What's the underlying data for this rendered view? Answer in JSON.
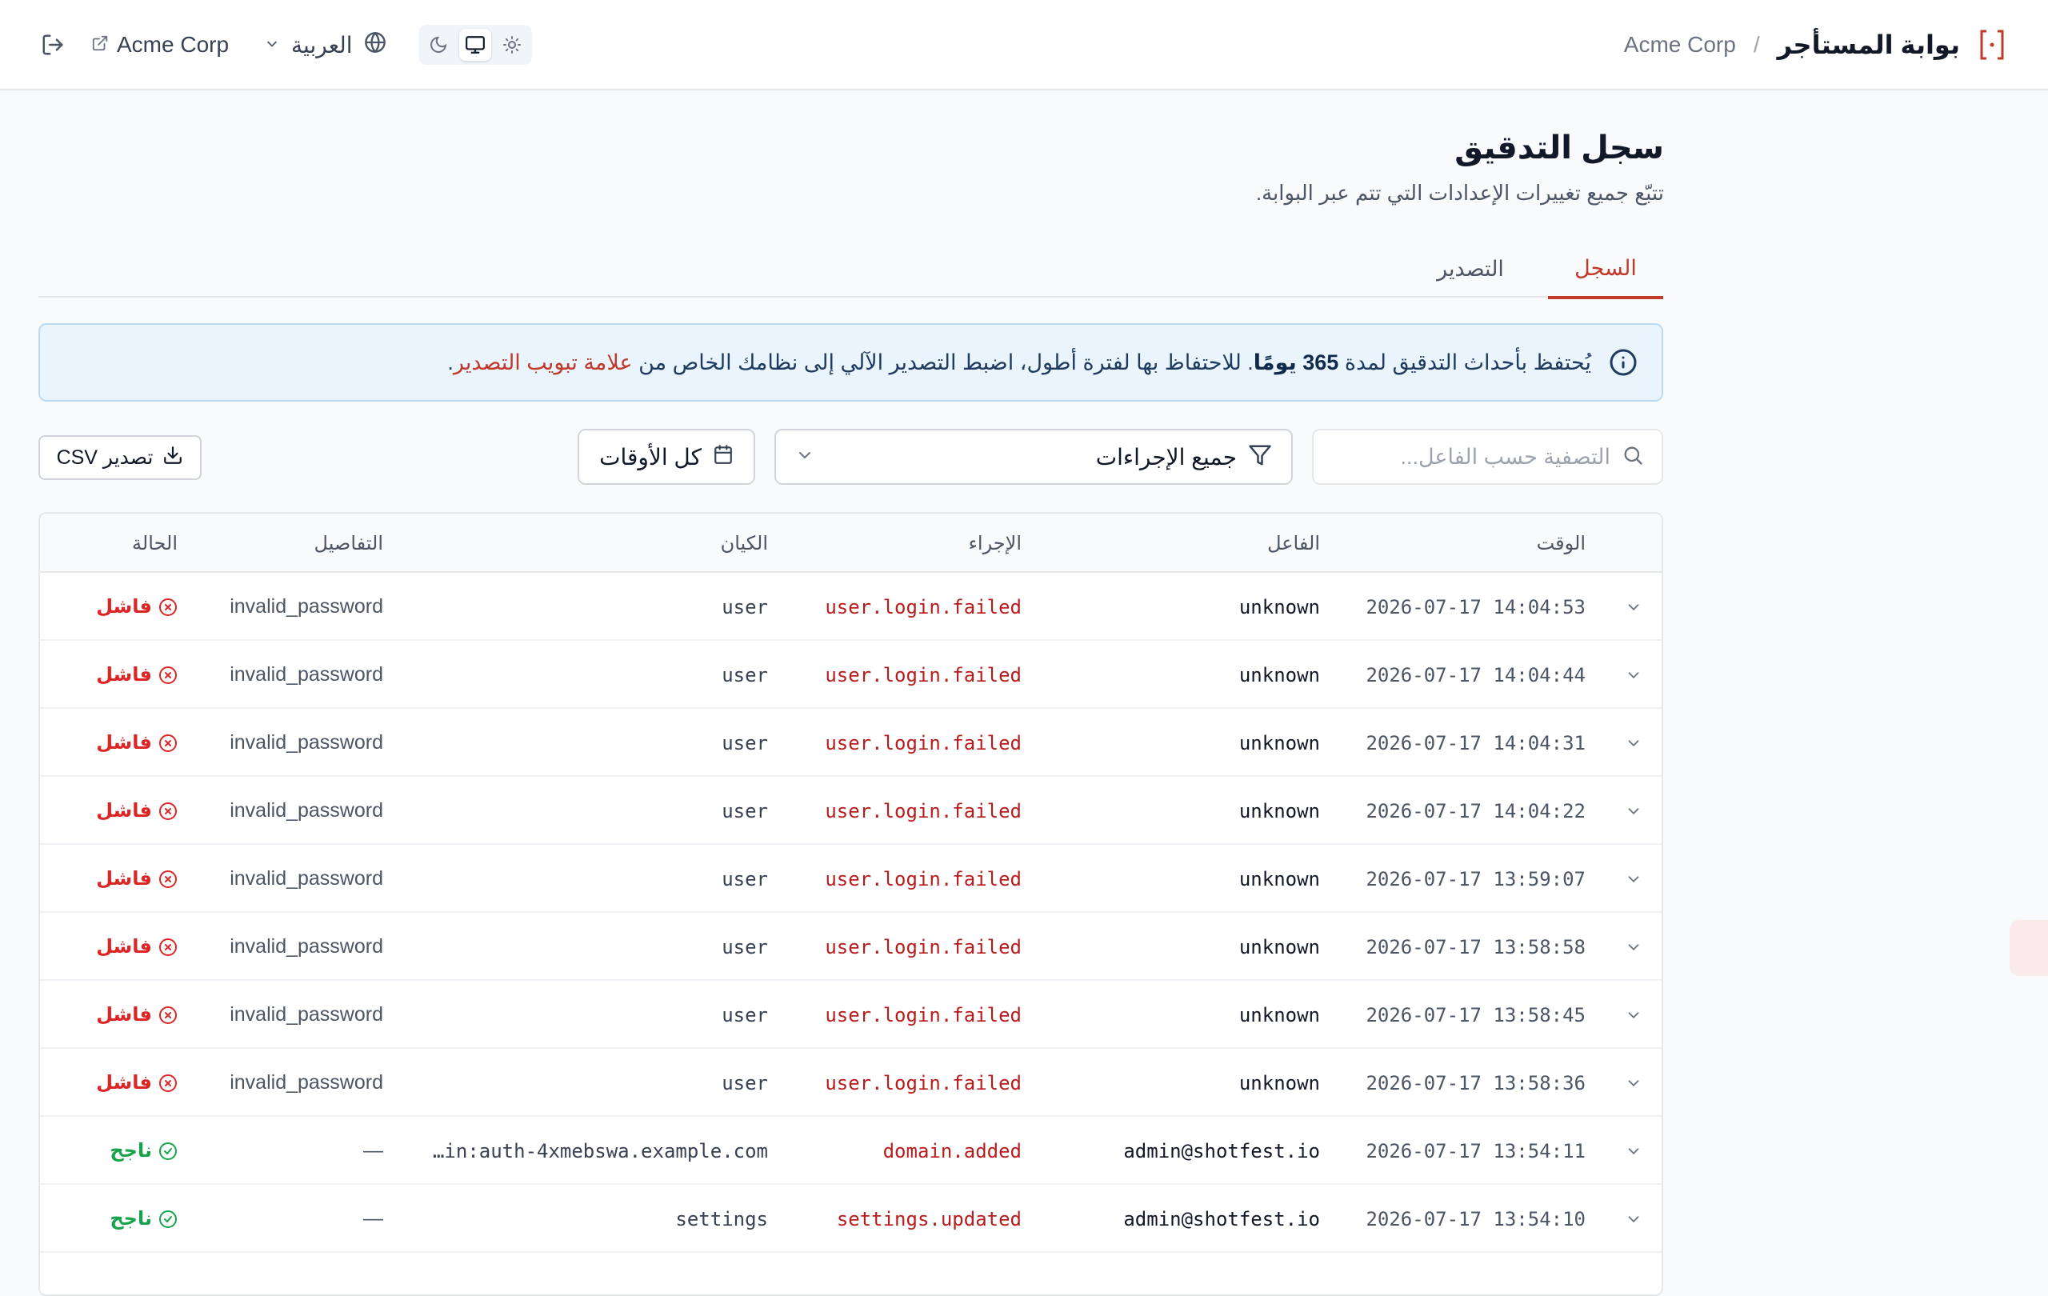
{
  "header": {
    "portal_title": "بوابة المستأجر",
    "separator": "/",
    "tenant_name": "Acme Corp",
    "tenant_link": "Acme Corp",
    "language": "العربية"
  },
  "page": {
    "title": "سجل التدقيق",
    "subtitle": "تتبّع جميع تغييرات الإعدادات التي تتم عبر البوابة."
  },
  "tabs": [
    {
      "label": "السجل",
      "active": true
    },
    {
      "label": "التصدير",
      "active": false
    }
  ],
  "banner": {
    "prefix": "يُحتفظ بأحداث التدقيق لمدة",
    "retention": "365 يومًا",
    "middle": ". للاحتفاظ بها لفترة أطول، اضبط التصدير الآلي إلى نظامك الخاص من",
    "link": "علامة تبويب التصدير",
    "suffix": "."
  },
  "filters": {
    "search_placeholder": "التصفية حسب الفاعل...",
    "search_value": "",
    "action_filter": "جميع الإجراءات",
    "time_filter": "كل الأوقات",
    "export_csv": "تصدير CSV"
  },
  "table": {
    "columns": {
      "time": "الوقت",
      "actor": "الفاعل",
      "action": "الإجراء",
      "entity": "الكيان",
      "details": "التفاصيل",
      "status": "الحالة"
    },
    "status_labels": {
      "failed": "فاشل",
      "success": "ناجح"
    },
    "rows": [
      {
        "time": "2026-07-17 14:04:53",
        "actor": "unknown",
        "action": "user.login.failed",
        "entity": "user",
        "details": "invalid_password",
        "status": "فاشل"
      },
      {
        "time": "2026-07-17 14:04:44",
        "actor": "unknown",
        "action": "user.login.failed",
        "entity": "user",
        "details": "invalid_password",
        "status": "فاشل"
      },
      {
        "time": "2026-07-17 14:04:31",
        "actor": "unknown",
        "action": "user.login.failed",
        "entity": "user",
        "details": "invalid_password",
        "status": "فاشل"
      },
      {
        "time": "2026-07-17 14:04:22",
        "actor": "unknown",
        "action": "user.login.failed",
        "entity": "user",
        "details": "invalid_password",
        "status": "فاشل"
      },
      {
        "time": "2026-07-17 13:59:07",
        "actor": "unknown",
        "action": "user.login.failed",
        "entity": "user",
        "details": "invalid_password",
        "status": "فاشل"
      },
      {
        "time": "2026-07-17 13:58:58",
        "actor": "unknown",
        "action": "user.login.failed",
        "entity": "user",
        "details": "invalid_password",
        "status": "فاشل"
      },
      {
        "time": "2026-07-17 13:58:45",
        "actor": "unknown",
        "action": "user.login.failed",
        "entity": "user",
        "details": "invalid_password",
        "status": "فاشل"
      },
      {
        "time": "2026-07-17 13:58:36",
        "actor": "unknown",
        "action": "user.login.failed",
        "entity": "user",
        "details": "invalid_password",
        "status": "فاشل"
      },
      {
        "time": "2026-07-17 13:54:11",
        "actor": "admin@shotfest.io",
        "action": "domain.added",
        "entity": "…in:auth-4xmebswa.example.com",
        "details": "—",
        "status": "ناجح"
      },
      {
        "time": "2026-07-17 13:54:10",
        "actor": "admin@shotfest.io",
        "action": "settings.updated",
        "entity": "settings",
        "details": "—",
        "status": "ناجح"
      }
    ]
  },
  "colors": {
    "accent": "#c0392b",
    "failed": "#dc2626",
    "success": "#16a34a",
    "banner_bg": "#eaf4fd"
  }
}
